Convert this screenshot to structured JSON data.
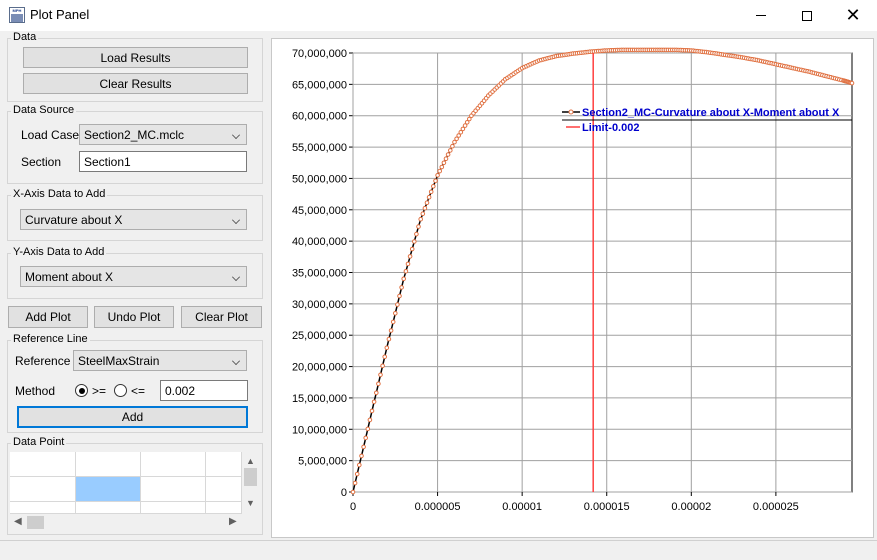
{
  "window": {
    "title": "Plot Panel",
    "icon_label": "MPH"
  },
  "data_group": {
    "label": "Data",
    "load_results": "Load Results",
    "clear_results": "Clear Results"
  },
  "data_source": {
    "label": "Data Source",
    "load_case_label": "Load Case",
    "load_case_value": "Section2_MC.mclc",
    "section_label": "Section",
    "section_value": "Section1"
  },
  "x_axis_group": {
    "label": "X-Axis Data to Add",
    "value": "Curvature about X"
  },
  "y_axis_group": {
    "label": "Y-Axis Data to Add",
    "value": "Moment about X"
  },
  "plot_buttons": {
    "add": "Add Plot",
    "undo": "Undo Plot",
    "clear": "Clear Plot"
  },
  "reference_line": {
    "label": "Reference Line",
    "reference_label": "Reference",
    "reference_value": "SteelMaxStrain",
    "method_label": "Method",
    "ge_label": ">=",
    "le_label": "<=",
    "ge_selected": true,
    "threshold": "0.002",
    "add_label": "Add"
  },
  "data_point": {
    "label": "Data Point",
    "selected_row": 1,
    "selected_col": 1
  },
  "colors": {
    "accent": "#0078d7",
    "curve": "#000000",
    "marker": "#e07040",
    "limit": "#ff4040",
    "legend_text": "#0000cc",
    "selection": "#99ccff"
  },
  "chart_data": {
    "type": "line",
    "title": "",
    "xlabel": "",
    "ylabel": "",
    "xlim": [
      0,
      2.95e-05
    ],
    "ylim": [
      0,
      70000000
    ],
    "x_ticks": [
      0,
      5e-06,
      1e-05,
      1.5e-05,
      2e-05,
      2.5e-05
    ],
    "x_tick_labels": [
      "0",
      "0.000005",
      "0.00001",
      "0.000015",
      "0.00002",
      "0.000025"
    ],
    "y_ticks": [
      0,
      5000000,
      10000000,
      15000000,
      20000000,
      25000000,
      30000000,
      35000000,
      40000000,
      45000000,
      50000000,
      55000000,
      60000000,
      65000000,
      70000000
    ],
    "y_tick_labels": [
      "0",
      "5,000,000",
      "10,000,000",
      "15,000,000",
      "20,000,000",
      "25,000,000",
      "30,000,000",
      "35,000,000",
      "40,000,000",
      "45,000,000",
      "50,000,000",
      "55,000,000",
      "60,000,000",
      "65,000,000",
      "70,000,000"
    ],
    "grid": true,
    "legend_position": "top-right",
    "series": [
      {
        "name": "Section2_MC-Curvature about X-Moment about X",
        "x": [
          0,
          1e-06,
          2e-06,
          3e-06,
          4e-06,
          5e-06,
          6e-06,
          7e-06,
          8e-06,
          9e-06,
          1e-05,
          1.1e-05,
          1.2e-05,
          1.3e-05,
          1.4e-05,
          1.5e-05,
          1.6e-05,
          1.7e-05,
          1.8e-05,
          1.9e-05,
          2e-05,
          2.1e-05,
          2.2e-05,
          2.3e-05,
          2.4e-05,
          2.5e-05,
          2.6e-05,
          2.7e-05,
          2.8e-05,
          2.9e-05,
          2.95e-05
        ],
        "y": [
          0,
          11500000,
          23000000,
          34000000,
          43500000,
          50500000,
          55800000,
          60000000,
          63200000,
          65800000,
          67600000,
          68800000,
          69500000,
          69900000,
          70200000,
          70400000,
          70500000,
          70500000,
          70500000,
          70500000,
          70400000,
          70100000,
          69700000,
          69300000,
          68800000,
          68200000,
          67600000,
          67000000,
          66300000,
          65600000,
          65200000
        ]
      },
      {
        "name": "Limit-0.002",
        "x": [
          1.42e-05,
          1.42e-05
        ],
        "y": [
          0,
          70500000
        ]
      }
    ]
  }
}
